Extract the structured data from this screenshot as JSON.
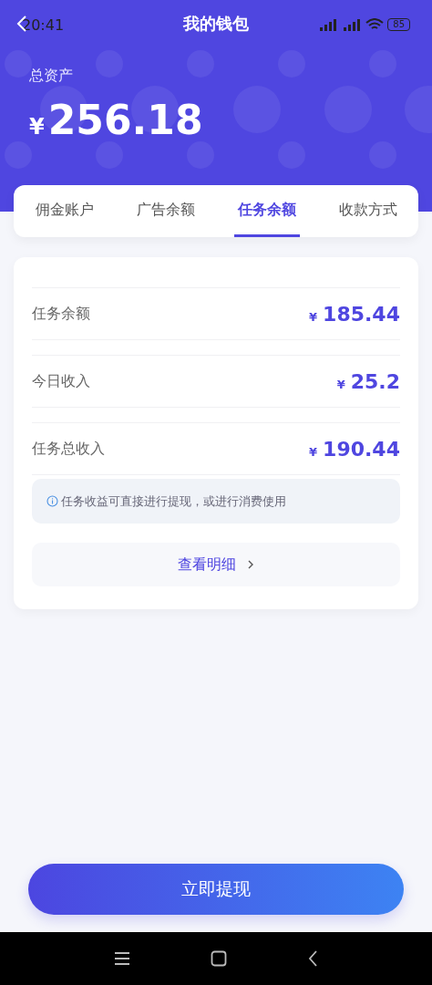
{
  "status_bar": {
    "time": "20:41",
    "battery": "85"
  },
  "header": {
    "title": "我的钱包",
    "total_label": "总资产",
    "currency": "¥",
    "total": "256.18"
  },
  "tabs": [
    {
      "label": "佣金账户",
      "selected": false
    },
    {
      "label": "广告余额",
      "selected": false
    },
    {
      "label": "任务余额",
      "selected": true
    },
    {
      "label": "收款方式",
      "selected": false
    }
  ],
  "rows": [
    {
      "label": "任务余额",
      "currency": "¥",
      "value": "185.44"
    },
    {
      "label": "今日收入",
      "currency": "¥",
      "value": "25.2"
    },
    {
      "label": "任务总收入",
      "currency": "¥",
      "value": "190.44"
    }
  ],
  "notice": "任务收益可直接进行提现，或进行消费使用",
  "details_button": "查看明细",
  "withdraw_button": "立即提现"
}
